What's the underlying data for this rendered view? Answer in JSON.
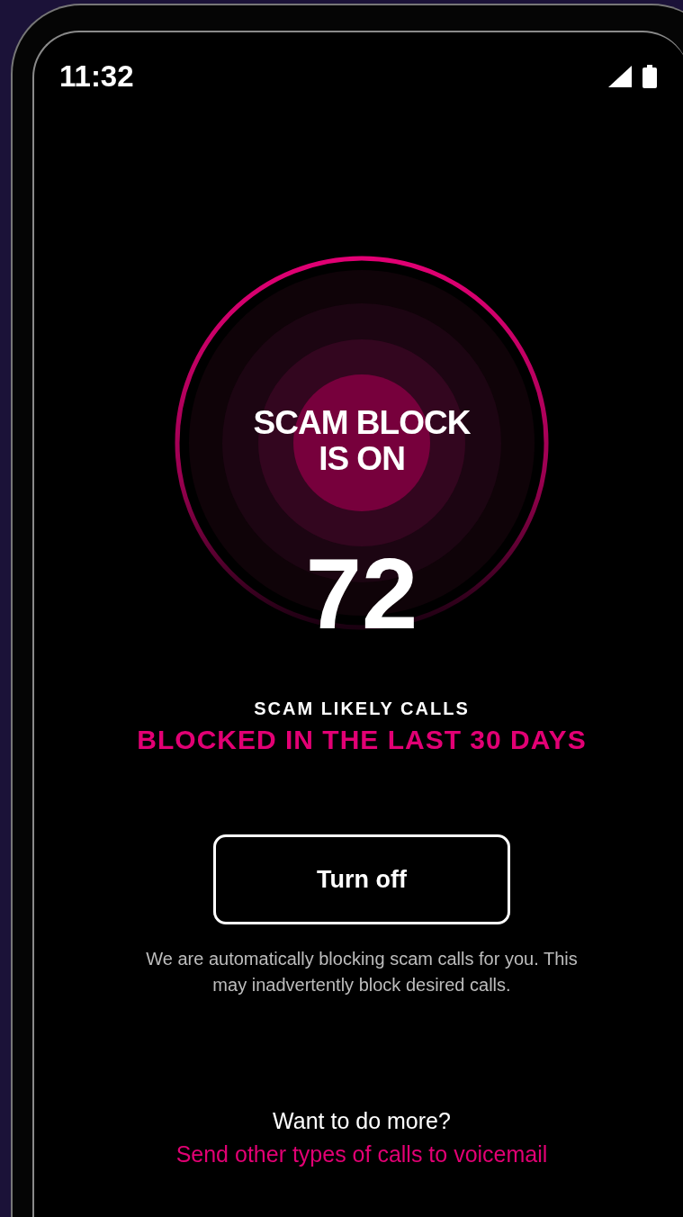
{
  "status_bar": {
    "time": "11:32"
  },
  "scam_block": {
    "heading": "SCAM BLOCK IS ON",
    "count": "72",
    "count_label": "SCAM LIKELY CALLS",
    "period": "BLOCKED IN THE LAST 30 DAYS"
  },
  "button": {
    "label": "Turn off"
  },
  "description": "We are automatically blocking scam calls for you. This may inadvertently block desired calls.",
  "more": {
    "prompt": "Want to do more?",
    "link": "Send other types of calls to voicemail"
  }
}
